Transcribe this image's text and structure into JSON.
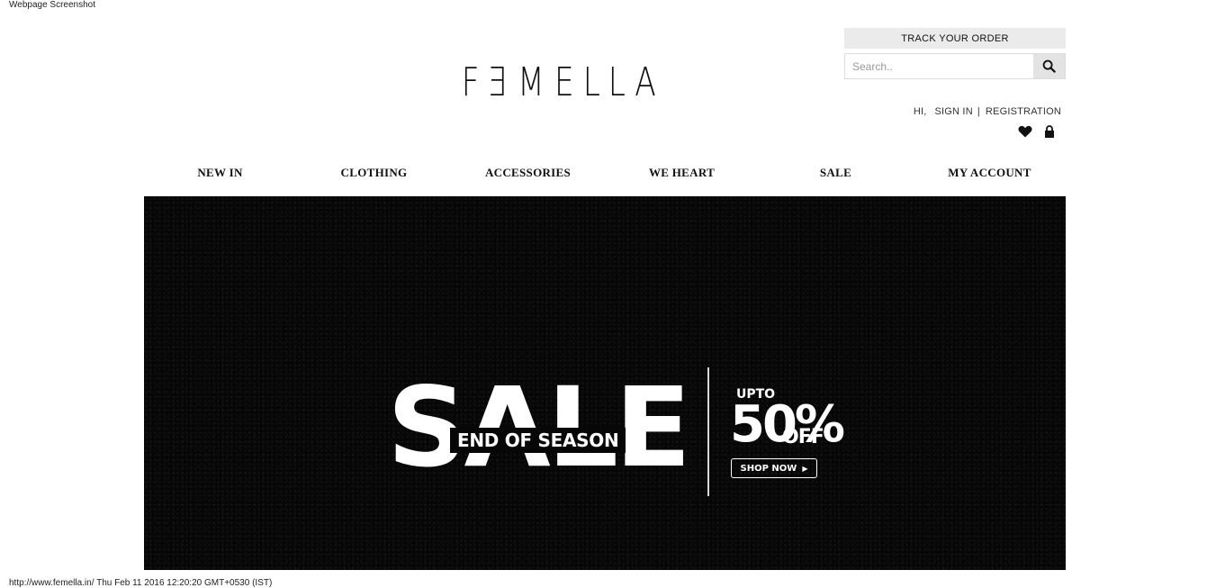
{
  "page": {
    "caption_top": "Webpage Screenshot",
    "caption_bottom": "http://www.femella.in/ Thu Feb 11 2016 12:20:20 GMT+0530 (IST)"
  },
  "header": {
    "logo_letters": [
      "F",
      "E",
      "M",
      "E",
      "L",
      "L",
      "A"
    ],
    "track_order_label": "TRACK YOUR ORDER",
    "search": {
      "placeholder": "Search..",
      "value": "",
      "icon": "search-icon"
    },
    "account": {
      "greeting": "HI,",
      "sign_in": "SIGN IN",
      "separator": "|",
      "registration": "REGISTRATION"
    },
    "icons": [
      "heart-icon",
      "lock-icon"
    ]
  },
  "nav": {
    "items": [
      {
        "label": "NEW IN"
      },
      {
        "label": "CLOTHING"
      },
      {
        "label": "ACCESSORIES"
      },
      {
        "label": "WE HEART"
      },
      {
        "label": "SALE"
      },
      {
        "label": "MY ACCOUNT"
      }
    ]
  },
  "banner": {
    "sale_word": "SALE",
    "sub_title": "END OF SEASON",
    "upto": "UPTO",
    "percent": "50%",
    "off": "OFF",
    "cta": "SHOP NOW",
    "background_color": "#070707"
  }
}
